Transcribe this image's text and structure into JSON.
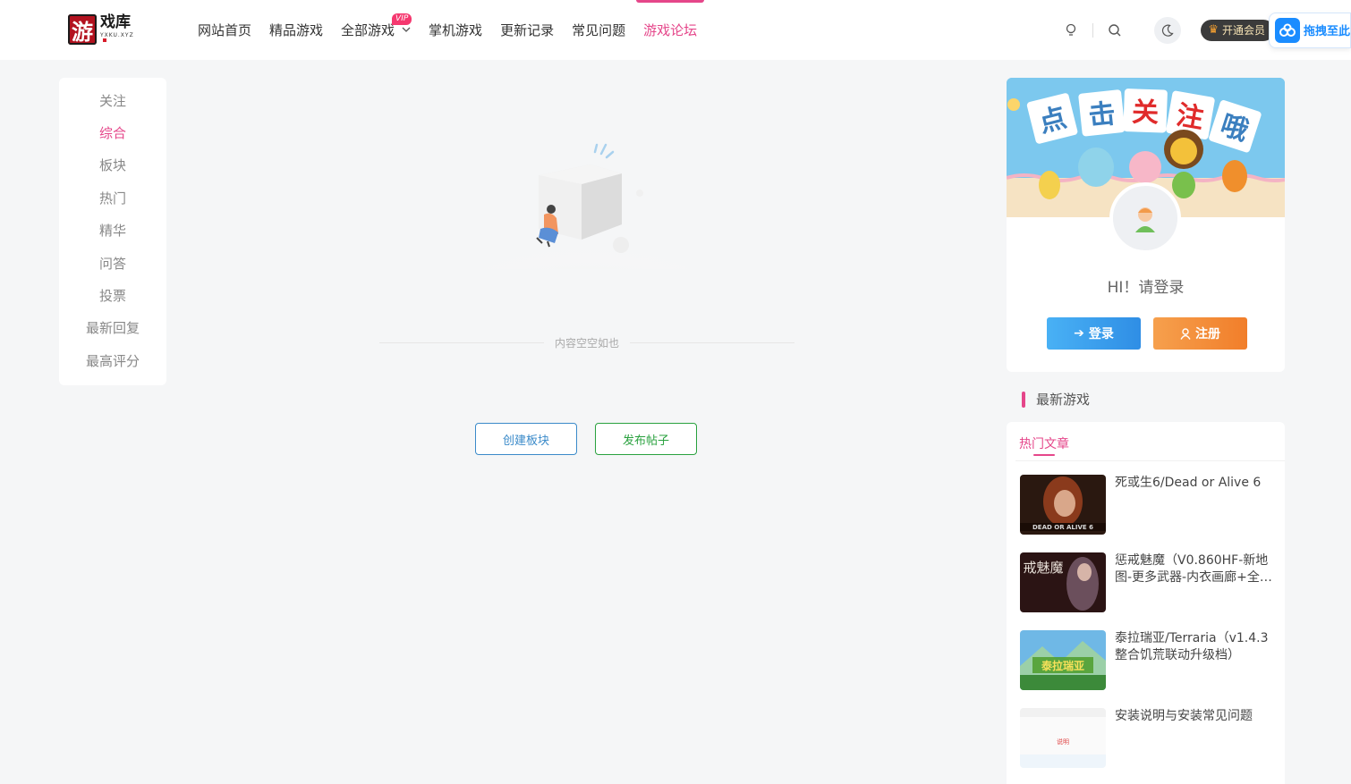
{
  "header": {
    "logo": {
      "main": "游戏库",
      "sub": "YXKU.XYZ"
    },
    "nav": [
      {
        "label": "网站首页"
      },
      {
        "label": "精品游戏"
      },
      {
        "label": "全部游戏",
        "badge": "VIP"
      },
      {
        "label": "掌机游戏"
      },
      {
        "label": "更新记录"
      },
      {
        "label": "常见问题"
      },
      {
        "label": "游戏论坛",
        "active": true
      }
    ],
    "vip_button": "开通会员",
    "drag_tab": "拖拽至此"
  },
  "left_menu": {
    "items": [
      "关注",
      "综合",
      "板块",
      "热门",
      "精华",
      "问答",
      "投票",
      "最新回复",
      "最高评分"
    ],
    "active_index": 1
  },
  "main": {
    "empty_text": "内容空空如也",
    "create_section": "创建板块",
    "publish_post": "发布帖子"
  },
  "profile": {
    "banner_text": [
      "点",
      "击",
      "关",
      "注",
      "哦"
    ],
    "greeting": "HI！请登录",
    "login": "登录",
    "register": "注册"
  },
  "sidebar": {
    "section_title": "最新游戏",
    "hot_tab": "热门文章",
    "articles": [
      {
        "title": "死或生6/Dead or Alive 6",
        "thumb_text": "DEAD OR ALIVE 6"
      },
      {
        "title": "惩戒魅魔（V0.860HF-新地图-更多武器-内衣画廊+全…",
        "thumb_text": "戒魅魔"
      },
      {
        "title": "泰拉瑞亚/Terraria（v1.4.3整合饥荒联动升级档）",
        "thumb_text": "泰拉瑞亚"
      },
      {
        "title": "安装说明与安装常见问题",
        "thumb_text": "说明"
      }
    ]
  },
  "colors": {
    "accent": "#e5468a",
    "blue": "#3a8ac9",
    "green": "#29a13e"
  }
}
